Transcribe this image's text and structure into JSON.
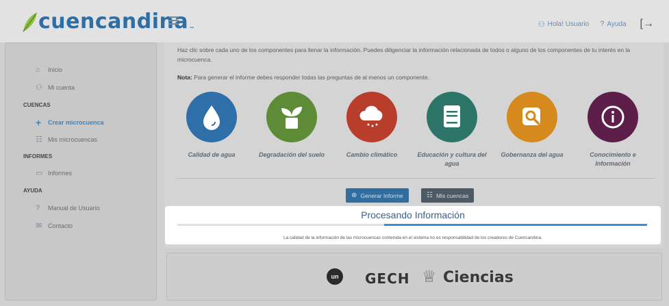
{
  "header": {
    "logo_text": "cuencandina",
    "logo_suffix": "..",
    "user_greeting": "Hola! Usuario",
    "help_label": "Ayuda"
  },
  "sidebar": {
    "items": [
      {
        "label": "Inicio",
        "icon": "home-icon"
      },
      {
        "label": "Mi cuenta",
        "icon": "user-icon"
      }
    ],
    "sections": [
      {
        "heading": "CUENCAS",
        "items": [
          {
            "label": "Crear microcuenca",
            "icon": "plus-icon",
            "active": true
          },
          {
            "label": "Mis microcuencas",
            "icon": "database-icon"
          }
        ]
      },
      {
        "heading": "INFORMES",
        "items": [
          {
            "label": "Informes",
            "icon": "folder-icon"
          }
        ]
      },
      {
        "heading": "AYUDA",
        "items": [
          {
            "label": "Manual de Usuario",
            "icon": "question-icon"
          },
          {
            "label": "Contacto",
            "icon": "mail-icon"
          }
        ]
      }
    ]
  },
  "main": {
    "intro": "Haz clic sobre cada uno de los componentes para llenar la información. Puedes diligenciar la información relacionada de todos o alguno de los componentes de tu interés en la microcuenca.",
    "note_label": "Nota:",
    "note_text": " Para generar el informe debes responder todas las preguntas de al menos un componente.",
    "components": [
      {
        "label": "Calidad de agua",
        "color": "#2f6fa9",
        "icon": "water-drop-icon"
      },
      {
        "label": "Degradación del suelo",
        "color": "#5e8b35",
        "icon": "plant-icon"
      },
      {
        "label": "Cambio climático",
        "color": "#b83d2a",
        "icon": "cloud-rain-icon"
      },
      {
        "label": "Educación y cultura del agua",
        "color": "#2d7469",
        "icon": "book-icon"
      },
      {
        "label": "Gobernanza del agua",
        "color": "#d6891c",
        "icon": "search-icon"
      },
      {
        "label": "Conocimiento e Información",
        "color": "#5d1f4a",
        "icon": "info-icon"
      }
    ],
    "generate_button": "Generar Informe",
    "basins_button": "Mis cuencas"
  },
  "modal": {
    "title": "Procesando Información",
    "progress_fraction": 0.56,
    "footer": "La calidad de la información de las microcuencas contenida en el sistema no es responsabilidad de los creadores de Cuencandina."
  },
  "footer": {
    "un_logo_text": "un",
    "gech_text": "GECH",
    "ciencias_text": "Ciencias"
  }
}
